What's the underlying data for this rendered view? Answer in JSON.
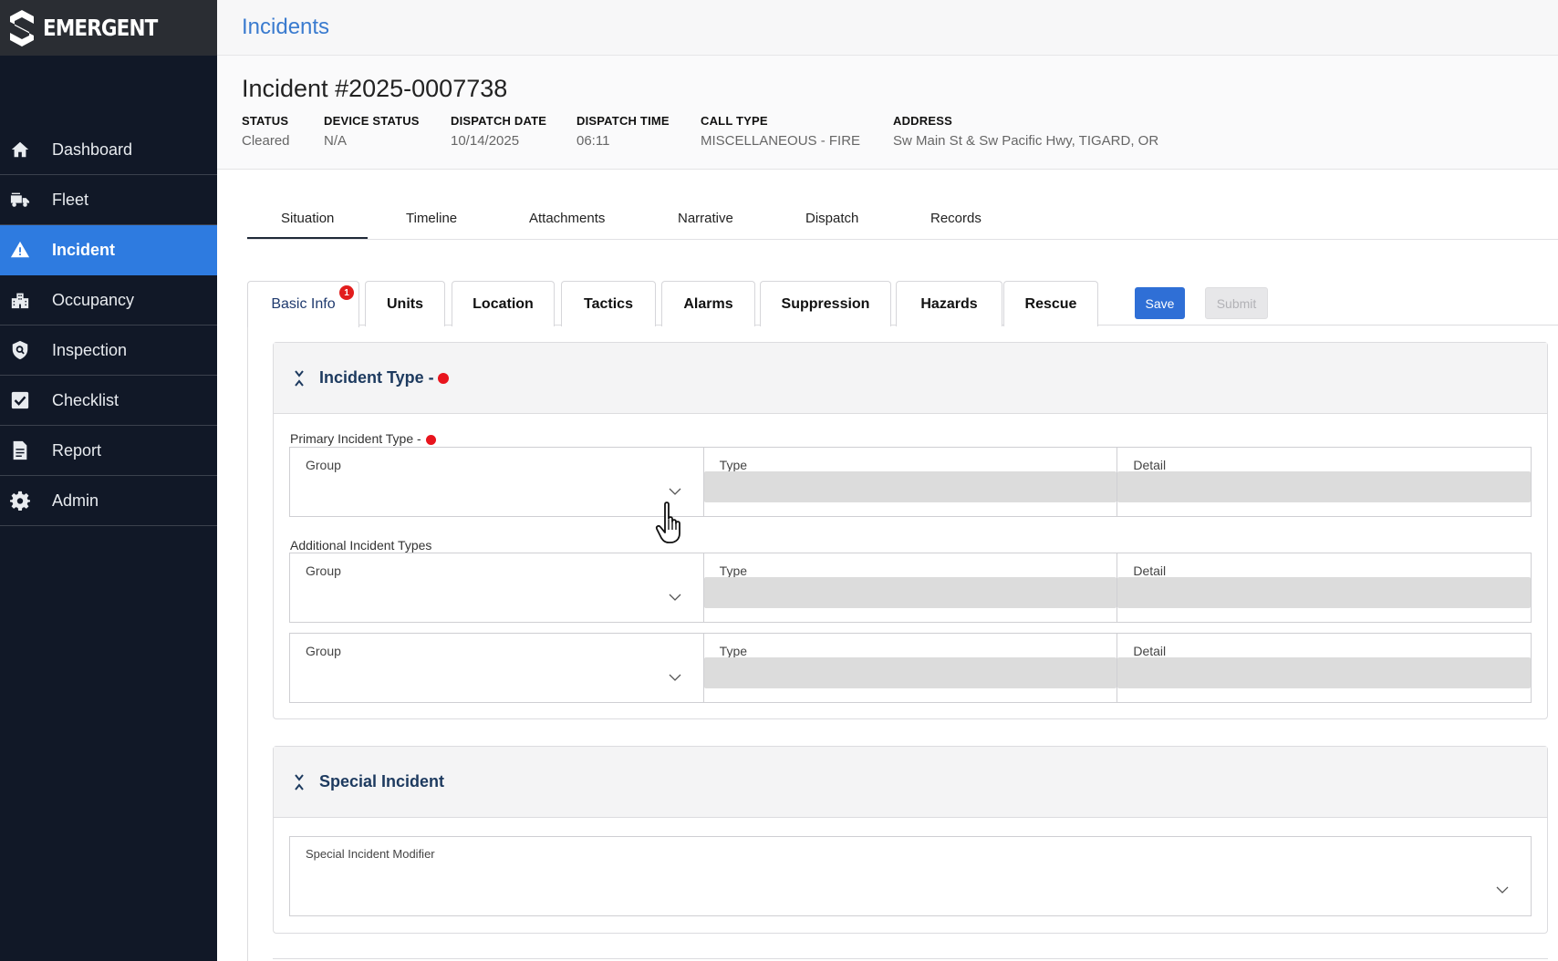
{
  "brand": {
    "name": "EMERGENT"
  },
  "sidebar": {
    "items": [
      {
        "label": "Dashboard",
        "icon": "home-icon",
        "active": false
      },
      {
        "label": "Fleet",
        "icon": "fire-truck-icon",
        "active": false
      },
      {
        "label": "Incident",
        "icon": "warning-icon",
        "active": true
      },
      {
        "label": "Occupancy",
        "icon": "building-icon",
        "active": false
      },
      {
        "label": "Inspection",
        "icon": "shield-search-icon",
        "active": false
      },
      {
        "label": "Checklist",
        "icon": "checkbox-icon",
        "active": false
      },
      {
        "label": "Report",
        "icon": "document-icon",
        "active": false
      },
      {
        "label": "Admin",
        "icon": "gear-icon",
        "active": false
      }
    ]
  },
  "topbar": {
    "title": "Incidents"
  },
  "incident": {
    "title": "Incident #2025-0007738",
    "meta": [
      {
        "label": "STATUS",
        "value": "Cleared"
      },
      {
        "label": "DEVICE STATUS",
        "value": "N/A"
      },
      {
        "label": "DISPATCH DATE",
        "value": "10/14/2025"
      },
      {
        "label": "DISPATCH TIME",
        "value": "06:11"
      },
      {
        "label": "CALL TYPE",
        "value": "MISCELLANEOUS - FIRE"
      },
      {
        "label": "ADDRESS",
        "value": "Sw Main St & Sw Pacific Hwy, TIGARD, OR"
      }
    ]
  },
  "main_tabs": [
    "Situation",
    "Timeline",
    "Attachments",
    "Narrative",
    "Dispatch",
    "Records"
  ],
  "main_tab_active": "Situation",
  "sub_tabs": [
    {
      "label": "Basic Info",
      "active": true,
      "badge": "1"
    },
    {
      "label": "Units"
    },
    {
      "label": "Location"
    },
    {
      "label": "Tactics"
    },
    {
      "label": "Alarms"
    },
    {
      "label": "Suppression"
    },
    {
      "label": "Hazards"
    },
    {
      "label": "Rescue"
    }
  ],
  "actions": {
    "save": "Save",
    "submit": "Submit"
  },
  "incident_type_panel": {
    "title": "Incident Type -",
    "primary_label": "Primary Incident Type -",
    "additional_label": "Additional Incident Types",
    "columns": {
      "group": "Group",
      "type": "Type",
      "detail": "Detail"
    }
  },
  "special_incident_panel": {
    "title": "Special Incident",
    "modifier_label": "Special Incident Modifier"
  },
  "colors": {
    "accent": "#2e7be0",
    "sidebar_bg": "#111827",
    "required_dot": "#e8141d",
    "panel_title": "#1d3a5f"
  }
}
